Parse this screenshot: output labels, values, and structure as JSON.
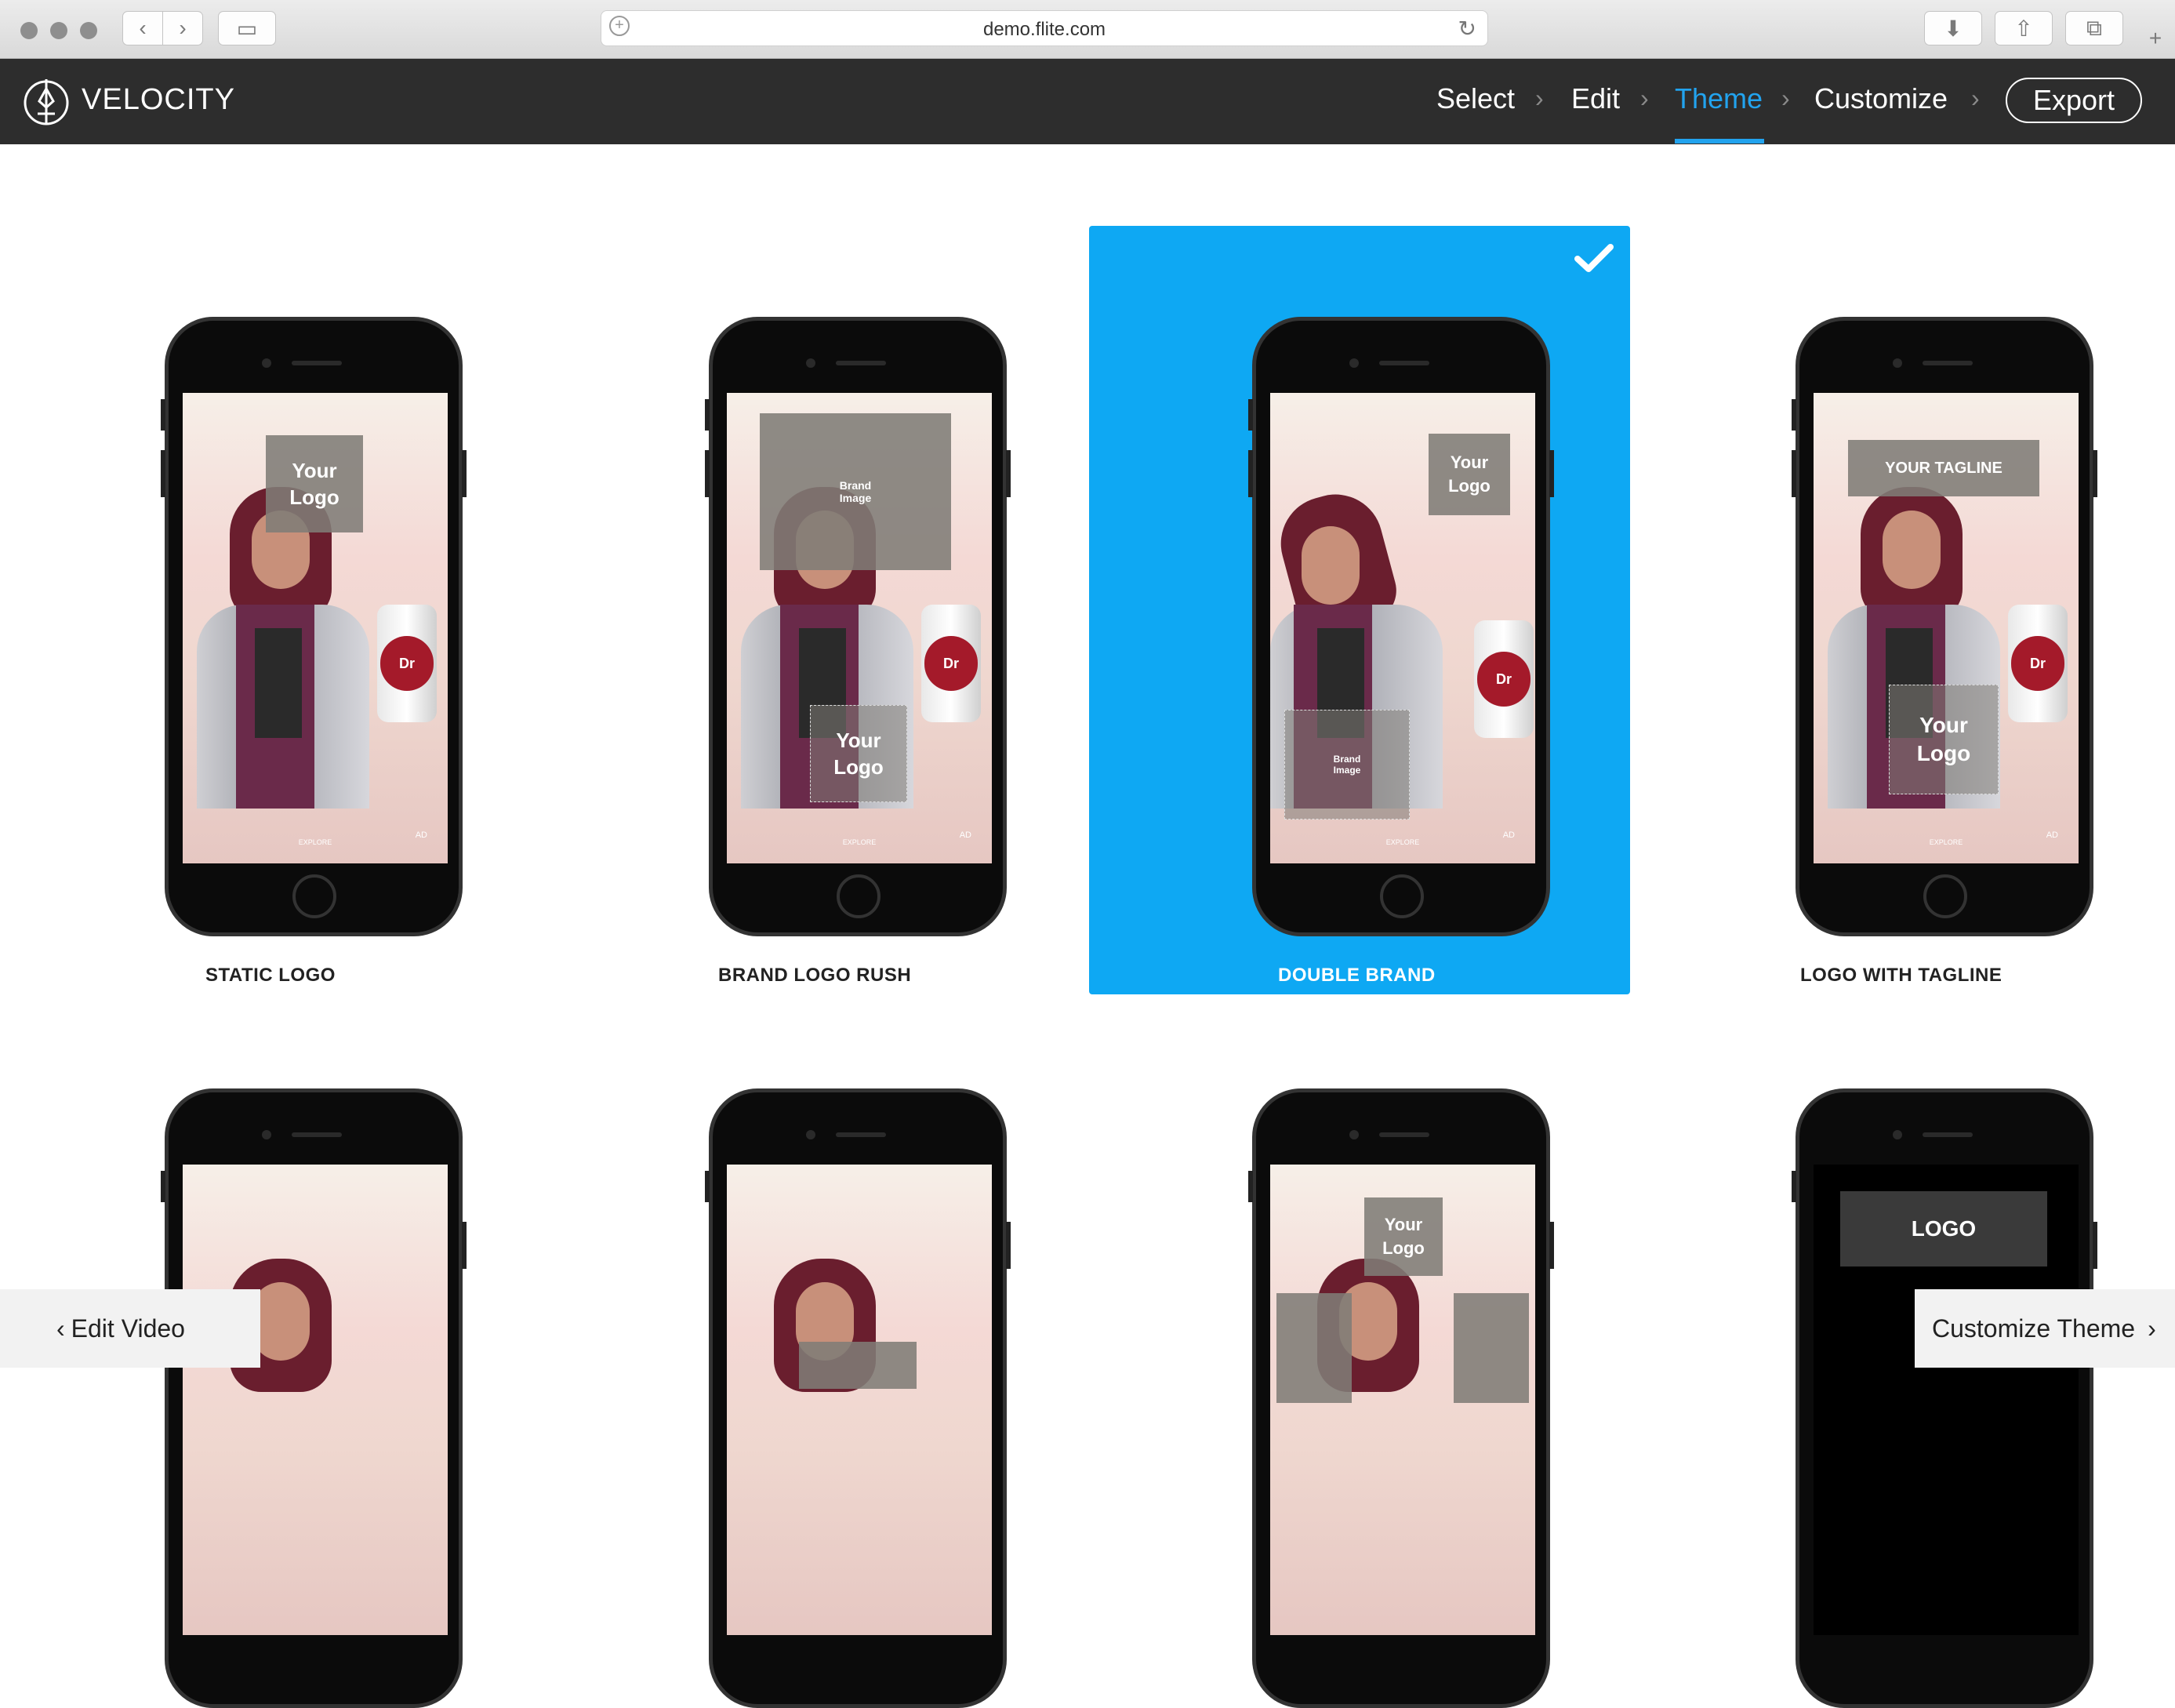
{
  "browser": {
    "url": "demo.flite.com",
    "buttons": {
      "back": "‹",
      "forward": "›",
      "sidebar": "▭",
      "download": "⬇",
      "share": "⇧",
      "tabs": "⧉",
      "new_tab": "+"
    }
  },
  "app": {
    "brand": "VELOCITY",
    "steps": [
      {
        "label": "Select",
        "active": false
      },
      {
        "label": "Edit",
        "active": false
      },
      {
        "label": "Theme",
        "active": true
      },
      {
        "label": "Customize",
        "active": false
      }
    ],
    "export_label": "Export",
    "accent_color": "#22a3ee",
    "selected_color": "#0ea8f3"
  },
  "themes": [
    {
      "name": "STATIC LOGO",
      "selected": false,
      "overlays": [
        "Your Logo"
      ]
    },
    {
      "name": "BRAND LOGO RUSH",
      "selected": false,
      "overlays": [
        "Brand Image",
        "Your Logo"
      ]
    },
    {
      "name": "DOUBLE BRAND",
      "selected": true,
      "overlays": [
        "Your Logo",
        "Brand Image"
      ]
    },
    {
      "name": "LOGO WITH TAGLINE",
      "selected": false,
      "overlays": [
        "YOUR TAGLINE",
        "Your Logo"
      ]
    },
    {
      "name": "",
      "selected": false,
      "overlays": []
    },
    {
      "name": "",
      "selected": false,
      "overlays": []
    },
    {
      "name": "",
      "selected": false,
      "overlays": [
        "Your Logo"
      ]
    },
    {
      "name": "",
      "selected": false,
      "overlays": [
        "LOGO"
      ]
    }
  ],
  "screen_labels": {
    "explore": "EXPLORE",
    "ad": "AD"
  },
  "footer": {
    "back_label": "Edit Video",
    "next_label": "Customize Theme"
  }
}
